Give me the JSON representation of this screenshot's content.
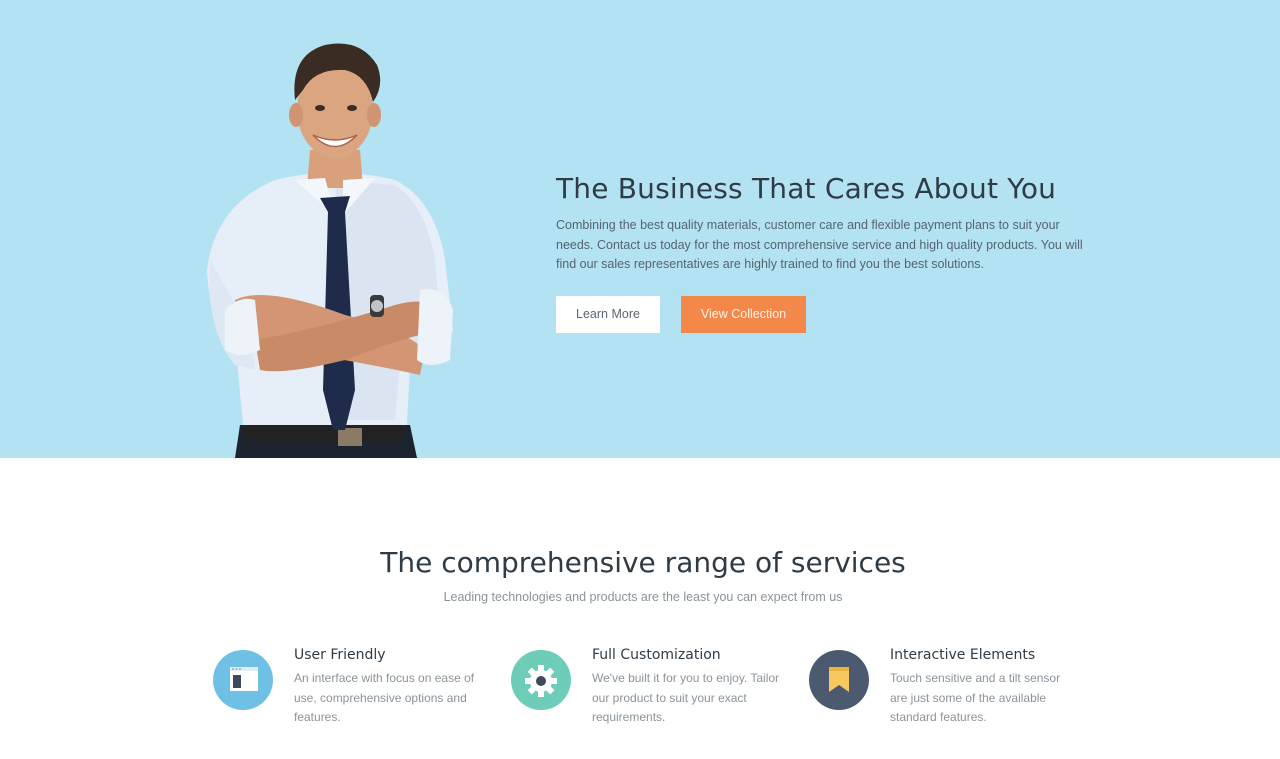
{
  "hero": {
    "title": "The Business That Cares About You",
    "description": "Combining the best quality materials, customer care and flexible payment plans to suit your needs. Contact us today for the most comprehensive service and high quality products. You will find our sales representatives are highly trained to find you the best solutions.",
    "learn_more_label": "Learn More",
    "view_collection_label": "View Collection",
    "background_color": "#b3e2f3",
    "accent_color": "#f4884a"
  },
  "services": {
    "title": "The comprehensive range of services",
    "subtitle": "Leading technologies and products are the least you can expect from us",
    "features": [
      {
        "title": "User Friendly",
        "text": "An interface with focus on ease of use, comprehensive options and features.",
        "icon": "window-icon",
        "icon_color": "#6ec1e4"
      },
      {
        "title": "Full Customization",
        "text": "We've built it for you to enjoy. Tailor our product to suit your exact requirements.",
        "icon": "gear-icon",
        "icon_color": "#6dcdb8"
      },
      {
        "title": "Interactive Elements",
        "text": "Touch sensitive and a tilt sensor are just some of the available standard features.",
        "icon": "bookmark-icon",
        "icon_color": "#4c5a70"
      }
    ]
  }
}
